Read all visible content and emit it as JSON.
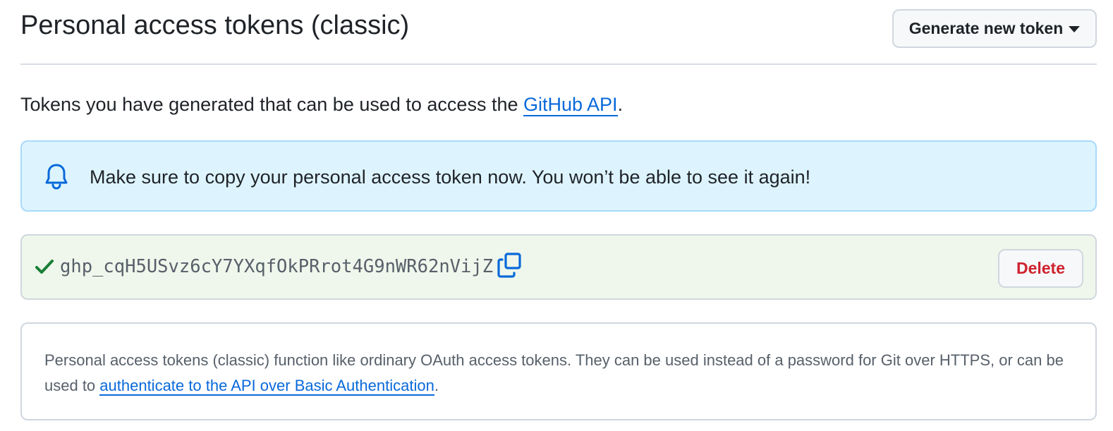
{
  "header": {
    "title": "Personal access tokens (classic)",
    "generate_label": "Generate new token"
  },
  "intro": {
    "text_before": "Tokens you have generated that can be used to access the ",
    "link_label": "GitHub API",
    "text_after": "."
  },
  "flash": {
    "icon": "bell-icon",
    "message": "Make sure to copy your personal access token now. You won’t be able to see it again!"
  },
  "token": {
    "status_icon": "check-icon",
    "value": "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",
    "copy_icon": "copy-icon",
    "delete_label": "Delete"
  },
  "note": {
    "text_before": "Personal access tokens (classic) function like ordinary OAuth access tokens. They can be used instead of a password for Git over HTTPS, or can be used to ",
    "link_label": "authenticate to the API over Basic Authentication",
    "text_after": "."
  },
  "colors": {
    "link": "#0969da",
    "flash_bg": "#ddf4ff",
    "flash_border": "#a8d9fb",
    "token_bg": "#eff7ec",
    "success": "#1a7f37",
    "danger": "#cf222e"
  }
}
